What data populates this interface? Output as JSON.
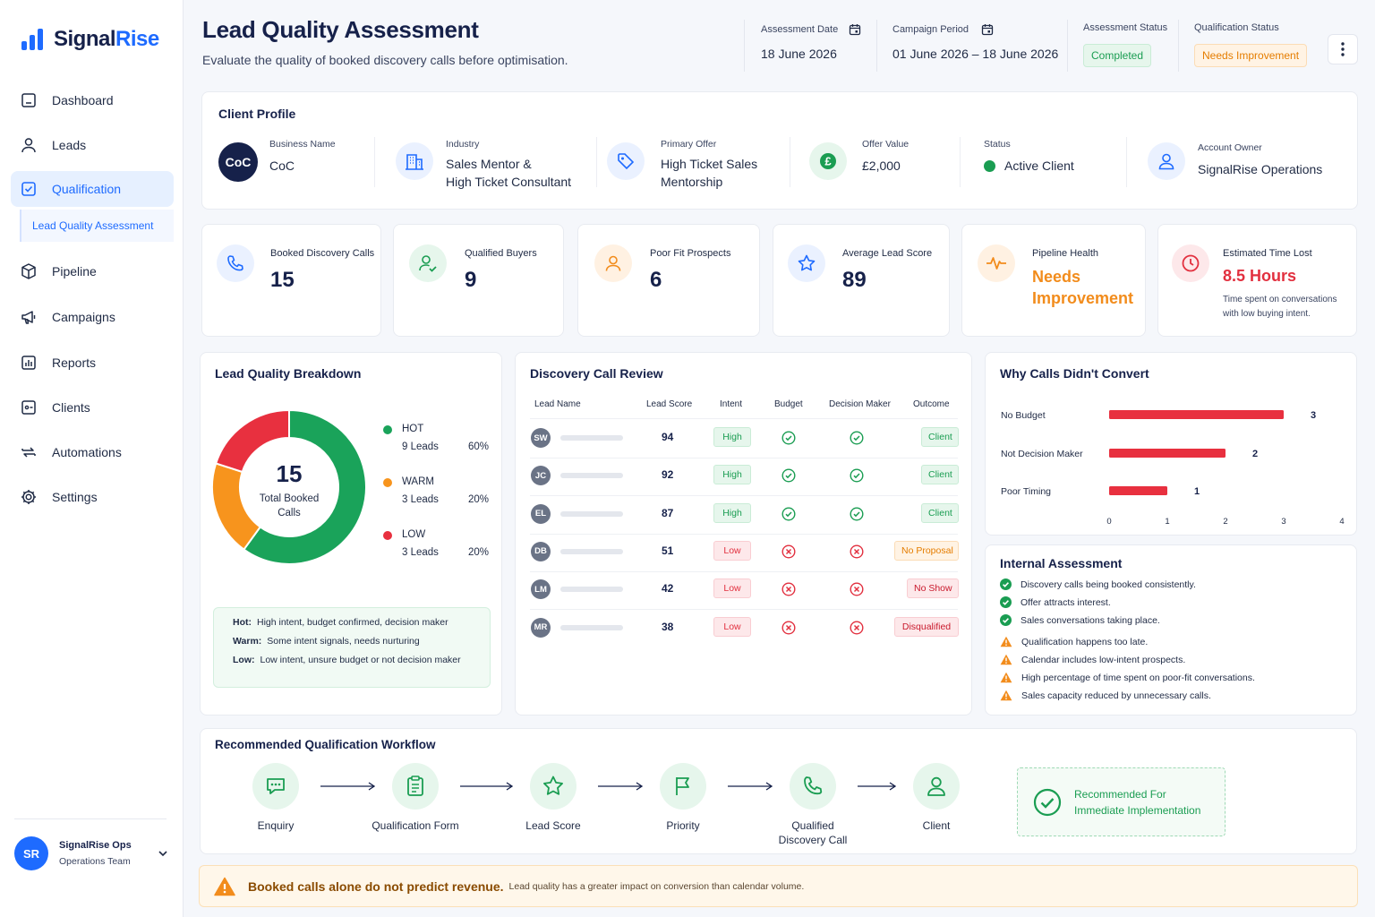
{
  "app": {
    "logo_prefix": "Signal",
    "logo_suffix": "Rise"
  },
  "sidebar": {
    "items": [
      {
        "label": "Dashboard",
        "icon": "dashboard-icon"
      },
      {
        "label": "Leads",
        "icon": "user-icon"
      },
      {
        "label": "Qualification",
        "icon": "checkbox-icon",
        "active": true
      },
      {
        "label": "Pipeline",
        "icon": "box-icon"
      },
      {
        "label": "Campaigns",
        "icon": "megaphone-icon"
      },
      {
        "label": "Reports",
        "icon": "report-icon"
      },
      {
        "label": "Clients",
        "icon": "id-card-icon"
      },
      {
        "label": "Automations",
        "icon": "repeat-icon"
      },
      {
        "label": "Settings",
        "icon": "gear-icon"
      }
    ],
    "sub_item": "Lead Quality Assessment",
    "user": {
      "initials": "SR",
      "name": "SignalRise Ops",
      "team": "Operations Team"
    }
  },
  "header": {
    "title": "Lead Quality Assessment",
    "subtitle": "Evaluate the quality of booked discovery calls before optimisation.",
    "assessment_date_label": "Assessment Date",
    "assessment_date": "18 June 2026",
    "campaign_period_label": "Campaign Period",
    "campaign_period": "01 June 2026 – 18 June 2026",
    "assessment_status_label": "Assessment Status",
    "assessment_status": "Completed",
    "qualification_status_label": "Qualification Status",
    "qualification_status": "Needs Improvement"
  },
  "client_profile": {
    "title": "Client Profile",
    "business_name_label": "Business Name",
    "business_name": "CoC",
    "logo_text": "CoC",
    "industry_label": "Industry",
    "industry_line1": "Sales Mentor &",
    "industry_line2": "High Ticket Consultant",
    "offer_label": "Primary Offer",
    "offer_line1": "High Ticket Sales",
    "offer_line2": "Mentorship",
    "offer_value_label": "Offer Value",
    "offer_value": "£2,000",
    "status_label": "Status",
    "status": "Active Client",
    "owner_label": "Account Owner",
    "owner": "SignalRise Operations"
  },
  "kpis": [
    {
      "label": "Booked Discovery Calls",
      "value": "15",
      "icon": "phone-icon",
      "color": "#1e6bff"
    },
    {
      "label": "Qualified Buyers",
      "value": "9",
      "icon": "user-check-icon",
      "color": "#1a9d52"
    },
    {
      "label": "Poor Fit Prospects",
      "value": "6",
      "icon": "user-icon",
      "color": "#f28c1c"
    },
    {
      "label": "Average Lead Score",
      "value": "89",
      "icon": "star-icon",
      "color": "#1e6bff"
    },
    {
      "label": "Pipeline Health",
      "value_line1": "Needs",
      "value_line2": "Improvement",
      "icon": "pulse-icon",
      "color": "#f28c1c"
    },
    {
      "label": "Estimated Time Lost",
      "value": "8.5 Hours",
      "note_line1": "Time spent on conversations",
      "note_line2": "with low buying intent.",
      "icon": "clock-icon",
      "color": "#e2303f"
    }
  ],
  "breakdown": {
    "title": "Lead Quality Breakdown",
    "center_value": "15",
    "center_line1": "Total Booked",
    "center_line2": "Calls",
    "segments": [
      {
        "name": "HOT",
        "leads": "9 Leads",
        "pct": "60%",
        "value": 60,
        "color": "#1aa35a"
      },
      {
        "name": "WARM",
        "leads": "3 Leads",
        "pct": "20%",
        "value": 20,
        "color": "#f7941d"
      },
      {
        "name": "LOW",
        "leads": "3 Leads",
        "pct": "20%",
        "value": 20,
        "color": "#e8303f"
      }
    ],
    "legend_notes": [
      {
        "key": "Hot:",
        "text": "High intent, budget confirmed, decision maker"
      },
      {
        "key": "Warm:",
        "text": "Some intent signals, needs nurturing"
      },
      {
        "key": "Low:",
        "text": "Low intent, unsure budget or not decision maker"
      }
    ]
  },
  "call_review": {
    "title": "Discovery Call Review",
    "columns": [
      "Lead Name",
      "Lead Score",
      "Intent",
      "Budget",
      "Decision Maker",
      "Outcome"
    ],
    "rows": [
      {
        "initials": "SW",
        "score": "94",
        "intent": "High",
        "budget": true,
        "dm": true,
        "outcome": "Client",
        "outcome_style": "green"
      },
      {
        "initials": "JC",
        "score": "92",
        "intent": "High",
        "budget": true,
        "dm": true,
        "outcome": "Client",
        "outcome_style": "green"
      },
      {
        "initials": "EL",
        "score": "87",
        "intent": "High",
        "budget": true,
        "dm": true,
        "outcome": "Client",
        "outcome_style": "green"
      },
      {
        "initials": "DB",
        "score": "51",
        "intent": "Low",
        "budget": false,
        "dm": false,
        "outcome": "No Proposal",
        "outcome_style": "orange"
      },
      {
        "initials": "LM",
        "score": "42",
        "intent": "Low",
        "budget": false,
        "dm": false,
        "outcome": "No Show",
        "outcome_style": "redtext"
      },
      {
        "initials": "MR",
        "score": "38",
        "intent": "Low",
        "budget": false,
        "dm": false,
        "outcome": "Disqualified",
        "outcome_style": "redtext"
      }
    ]
  },
  "why_not_convert": {
    "title": "Why Calls Didn't Convert",
    "chart_data": {
      "type": "bar",
      "orientation": "horizontal",
      "categories": [
        "No Budget",
        "Not Decision Maker",
        "Poor Timing"
      ],
      "values": [
        3,
        2,
        1
      ],
      "xlim": [
        0,
        4
      ],
      "xticks": [
        "0",
        "1",
        "2",
        "3",
        "4"
      ],
      "color": "#e8303f"
    }
  },
  "internal_assessment": {
    "title": "Internal Assessment",
    "positives": [
      "Discovery calls being booked consistently.",
      "Offer attracts interest.",
      "Sales conversations taking place."
    ],
    "warnings": [
      "Qualification happens too late.",
      "Calendar includes low-intent prospects.",
      "High percentage of time spent on poor-fit conversations.",
      "Sales capacity reduced by unnecessary calls."
    ]
  },
  "workflow": {
    "title": "Recommended Qualification Workflow",
    "steps": [
      {
        "line1": "Enquiry",
        "line2": "",
        "icon": "chat-icon"
      },
      {
        "line1": "Qualification Form",
        "line2": "",
        "icon": "clipboard-icon"
      },
      {
        "line1": "Lead Score",
        "line2": "",
        "icon": "star-icon"
      },
      {
        "line1": "Priority",
        "line2": "",
        "icon": "flag-icon"
      },
      {
        "line1": "Qualified",
        "line2": "Discovery Call",
        "icon": "phone-icon"
      },
      {
        "line1": "Client",
        "line2": "",
        "icon": "user-icon"
      }
    ],
    "recommend_line1": "Recommended For",
    "recommend_line2": "Immediate Implementation"
  },
  "footer_alert": {
    "bold": "Booked calls alone do not predict revenue.",
    "text": "Lead quality has a greater impact on conversion than calendar volume."
  }
}
